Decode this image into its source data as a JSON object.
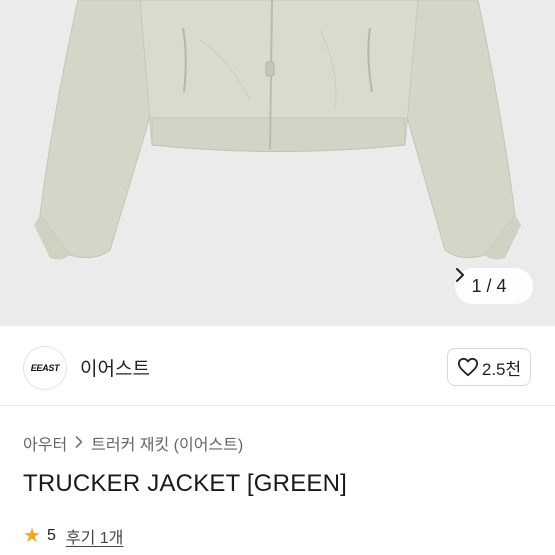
{
  "gallery": {
    "current": 1,
    "total": 4,
    "counter_text": "1 / 4",
    "next_icon": "chevron-right-icon"
  },
  "shop": {
    "logo_text": "EEAST",
    "name": "이어스트",
    "likes_label": "2.5천",
    "like_icon": "heart-icon"
  },
  "breadcrumb": {
    "level1": "아우터",
    "level2": "트러커 재킷 (이어스트)",
    "separator_icon": "chevron-right-icon"
  },
  "product": {
    "title": "TRUCKER JACKET [GREEN]"
  },
  "rating": {
    "score": "5",
    "reviews_label": "후기 1개",
    "star_color": "#f5a623"
  },
  "colors": {
    "jacket": "#d7d9cb",
    "hero_bg": "#ebebeb"
  }
}
